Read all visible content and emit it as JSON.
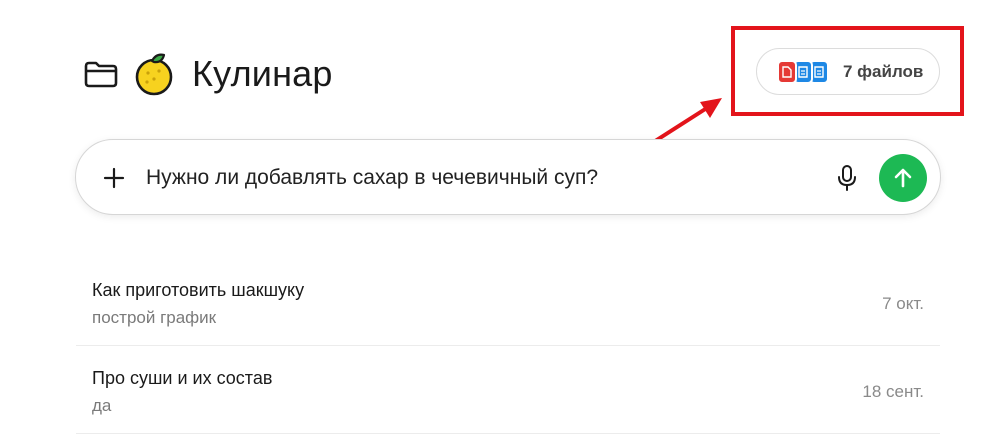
{
  "project": {
    "title": "Кулинар",
    "folder_icon": "folder-icon",
    "emoji_icon": "lemon-icon"
  },
  "files": {
    "count_label": "7 файлов",
    "icons": [
      "pdf-file-icon",
      "doc-file-icon",
      "doc-file-icon"
    ],
    "colors": {
      "pdf": "#e53935",
      "doc": "#1e88e5"
    }
  },
  "query": {
    "text": "Нужно ли добавлять сахар в чечевичный суп?",
    "add_icon": "plus-icon",
    "mic_icon": "microphone-icon",
    "send_icon": "arrow-up-icon",
    "send_color": "#1db954"
  },
  "chats": [
    {
      "title": "Как приготовить шакшуку",
      "subtitle": "построй график",
      "date": "7 окт."
    },
    {
      "title": "Про суши и их состав",
      "subtitle": "да",
      "date": "18 сент."
    }
  ],
  "annotation": {
    "color": "#e3141b"
  }
}
